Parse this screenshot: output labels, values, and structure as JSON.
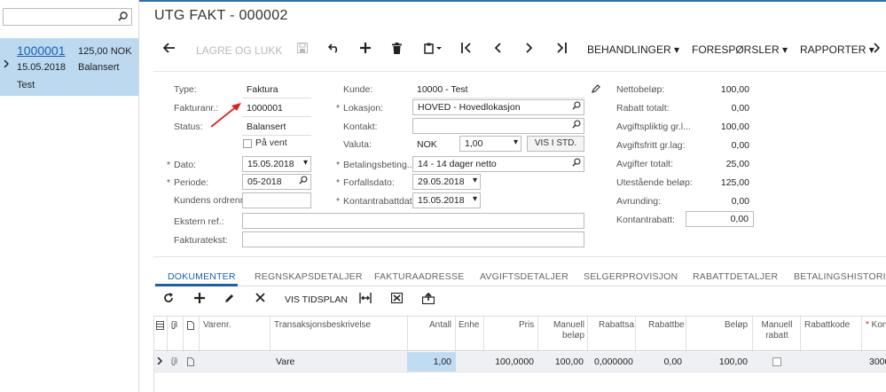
{
  "left_panel": {
    "search": {
      "placeholder": ""
    },
    "item": {
      "number": "1000001",
      "amount": "125,00 NOK",
      "date": "15.05.2018",
      "status": "Balansert",
      "text": "Test"
    }
  },
  "header": {
    "title": "UTG FAKT - 000002"
  },
  "toolbar": {
    "save_close": "LAGRE OG LUKK",
    "menus": [
      "BEHANDLINGER",
      "FORESPØRSLER",
      "RAPPORTER"
    ]
  },
  "form": {
    "type_label": "Type:",
    "type_value": "Faktura",
    "invnr_label": "Fakturanr.:",
    "invnr_value": "1000001",
    "status_label": "Status:",
    "status_value": "Balansert",
    "onhold_label": "På vent",
    "date_label": "Dato:",
    "date_value": "15.05.2018",
    "period_label": "Periode:",
    "period_value": "05-2018",
    "custorder_label": "Kundens ordrenr.:",
    "custorder_value": "",
    "extref_label": "Ekstern ref.:",
    "extref_value": "",
    "invtext_label": "Fakturatekst:",
    "invtext_value": "",
    "customer_label": "Kunde:",
    "customer_value": "10000 - Test",
    "location_label": "Lokasjon:",
    "location_value": "HOVED - Hovedlokasjon",
    "contact_label": "Kontakt:",
    "contact_value": "",
    "currency_label": "Valuta:",
    "currency_value": "NOK",
    "rate_value": "1,00",
    "vis_std": "VIS I STD.",
    "terms_label": "Betalingsbeting...",
    "terms_value": "14 - 14 dager netto",
    "due_label": "Forfallsdato:",
    "due_value": "29.05.2018",
    "disc_label": "Kontantrabattdato:",
    "disc_value": "15.05.2018"
  },
  "summary": [
    {
      "label": "Nettobeløp:",
      "value": "100,00"
    },
    {
      "label": "Rabatt totalt:",
      "value": "0,00"
    },
    {
      "label": "Avgiftspliktig gr.l...",
      "value": "100,00"
    },
    {
      "label": "Avgiftsfritt gr.lag:",
      "value": "0,00"
    },
    {
      "label": "Avgifter totalt:",
      "value": "25,00"
    },
    {
      "label": "Utestående beløp:",
      "value": "125,00"
    },
    {
      "label": "Avrunding:",
      "value": "0,00"
    },
    {
      "label": "Kontantrabatt:",
      "value": "0,00"
    }
  ],
  "tabs": [
    "DOKUMENTER",
    "REGNSKAPSDETALJER",
    "FAKTURAADRESSE",
    "AVGIFTSDETALJER",
    "SELGERPROVISJON",
    "RABATTDETALJER",
    "BETALINGSHISTORIKK"
  ],
  "grid": {
    "schedule_button": "VIS TIDSPLAN",
    "columns": [
      "Varenr.",
      "Transaksjonsbeskrivelse",
      "Antall",
      "Enhe",
      "Pris",
      "Manuell beløp",
      "Rabattsa",
      "Rabattbe",
      "Beløp",
      "Manuell rabatt",
      "Rabattkode",
      "Kon"
    ],
    "row": {
      "desc": "Vare",
      "qty": "1,00",
      "price": "100,0000",
      "manual_amount": "100,00",
      "disc_pct": "0,000000",
      "disc_amt": "0,00",
      "amount": "100,00",
      "account": "3000"
    }
  },
  "colors": {
    "accent": "#1a5fb4",
    "selected_row": "#bcd9f0",
    "annotation_arrow": "#e02020"
  }
}
